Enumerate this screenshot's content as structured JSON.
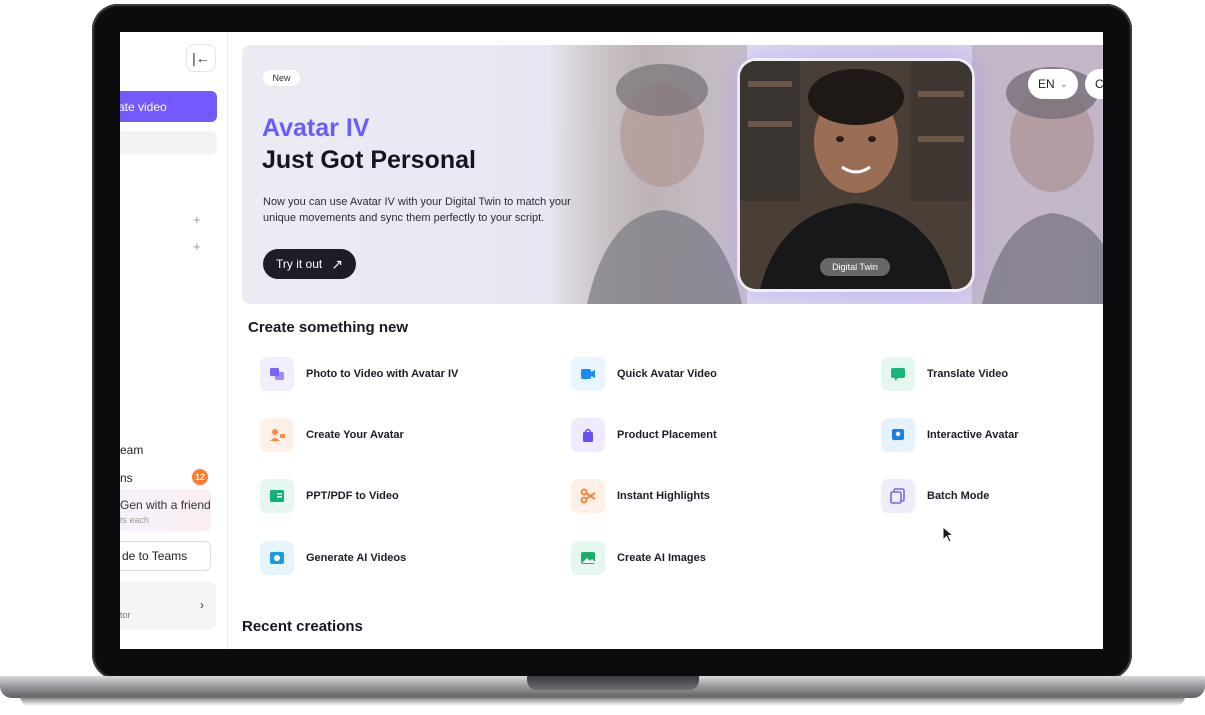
{
  "sidebar": {
    "collapse_glyph": "|←",
    "create_label": "ate video",
    "plus_glyph": "+",
    "team_label": "eam",
    "notifications_label": "ns",
    "notifications_count": "12",
    "refer_title": "Gen with a friend",
    "refer_sub": "ts each",
    "upgrade_label": "de to Teams",
    "user_role": "tor",
    "chevron": "›"
  },
  "banner": {
    "new_label": "New",
    "title_line1": "Avatar IV",
    "title_line2": "Just Got Personal",
    "description": "Now you can use Avatar IV with your Digital Twin to match your unique movements and sync them perfectly to your script.",
    "cta_label": "Try it out",
    "cta_arrow": "↗",
    "digital_twin_label": "Digital Twin",
    "lang_label": "EN",
    "lang_chevron": "⌄",
    "second_pill_label": "C"
  },
  "create_section": {
    "title": "Create something new",
    "tools": [
      {
        "label": "Photo to Video with Avatar IV",
        "icon": "photo-avatar-icon",
        "color": "#7b61ff",
        "bg": "#f1eeff"
      },
      {
        "label": "Quick Avatar Video",
        "icon": "video-camera-icon",
        "color": "#1b8df2",
        "bg": "#e8f4ff"
      },
      {
        "label": "Translate Video",
        "icon": "translate-icon",
        "color": "#14b87a",
        "bg": "#e5f8f0"
      },
      {
        "label": "Create Your Avatar",
        "icon": "user-add-icon",
        "color": "#ff8a3d",
        "bg": "#fff1e7"
      },
      {
        "label": "Product Placement",
        "icon": "shopping-bag-icon",
        "color": "#6b4cf6",
        "bg": "#efeaff"
      },
      {
        "label": "Interactive Avatar",
        "icon": "chat-avatar-icon",
        "color": "#1f7ee6",
        "bg": "#e7f2ff"
      },
      {
        "label": "PPT/PDF to Video",
        "icon": "slides-icon",
        "color": "#12b07a",
        "bg": "#e5f7ef"
      },
      {
        "label": "Instant Highlights",
        "icon": "scissors-icon",
        "color": "#ff7a2f",
        "bg": "#fff0e6"
      },
      {
        "label": "Batch Mode",
        "icon": "batch-icon",
        "color": "#7a66e0",
        "bg": "#efedfb"
      },
      {
        "label": "Generate AI Videos",
        "icon": "ai-video-icon",
        "color": "#1e9be0",
        "bg": "#e6f5fd"
      },
      {
        "label": "Create AI Images",
        "icon": "image-icon",
        "color": "#18b06f",
        "bg": "#e5f7ee"
      }
    ]
  },
  "recent_section": {
    "title": "Recent creations"
  },
  "colors": {
    "accent": "#7559ff",
    "badge": "#ff7a2f"
  }
}
